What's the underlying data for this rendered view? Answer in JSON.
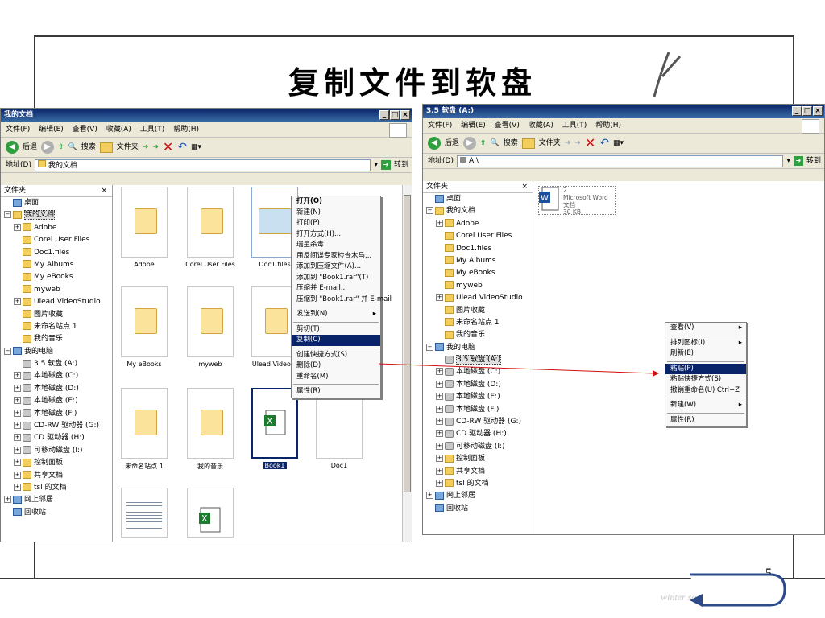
{
  "slide": {
    "title": "复制文件到软盘",
    "page_number": "5",
    "footer": "winter solitude - nlo"
  },
  "left_window": {
    "title": "我的文档",
    "menu": [
      "文件(F)",
      "编辑(E)",
      "查看(V)",
      "收藏(A)",
      "工具(T)",
      "帮助(H)"
    ],
    "toolbar": {
      "back": "后退",
      "search": "搜索",
      "folders": "文件夹"
    },
    "address_label": "地址(D)",
    "address_value": "我的文档",
    "go_label": "转到",
    "tree_header": "文件夹",
    "tree": [
      {
        "label": "桌面",
        "icon": "desktop-icon",
        "indent": 0,
        "plus": ""
      },
      {
        "label": "我的文档",
        "icon": "folder-icon",
        "indent": 0,
        "plus": "−",
        "selected": true
      },
      {
        "label": "Adobe",
        "icon": "folder-icon",
        "indent": 1,
        "plus": "+"
      },
      {
        "label": "Corel User Files",
        "icon": "folder-icon",
        "indent": 1,
        "plus": ""
      },
      {
        "label": "Doc1.files",
        "icon": "folder-icon",
        "indent": 1,
        "plus": ""
      },
      {
        "label": "My Albums",
        "icon": "folder-icon",
        "indent": 1,
        "plus": ""
      },
      {
        "label": "My eBooks",
        "icon": "folder-icon",
        "indent": 1,
        "plus": ""
      },
      {
        "label": "myweb",
        "icon": "folder-icon",
        "indent": 1,
        "plus": ""
      },
      {
        "label": "Ulead VideoStudio",
        "icon": "folder-icon",
        "indent": 1,
        "plus": "+"
      },
      {
        "label": "图片收藏",
        "icon": "folder-icon",
        "indent": 1,
        "plus": ""
      },
      {
        "label": "未命名站点 1",
        "icon": "folder-icon",
        "indent": 1,
        "plus": ""
      },
      {
        "label": "我的音乐",
        "icon": "folder-icon",
        "indent": 1,
        "plus": ""
      },
      {
        "label": "我的电脑",
        "icon": "computer-icon",
        "indent": 0,
        "plus": "−"
      },
      {
        "label": "3.5 软盘 (A:)",
        "icon": "floppy-icon",
        "indent": 1,
        "plus": ""
      },
      {
        "label": "本地磁盘 (C:)",
        "icon": "drive-icon",
        "indent": 1,
        "plus": "+"
      },
      {
        "label": "本地磁盘 (D:)",
        "icon": "drive-icon",
        "indent": 1,
        "plus": "+"
      },
      {
        "label": "本地磁盘 (E:)",
        "icon": "drive-icon",
        "indent": 1,
        "plus": "+"
      },
      {
        "label": "本地磁盘 (F:)",
        "icon": "drive-icon",
        "indent": 1,
        "plus": "+"
      },
      {
        "label": "CD-RW 驱动器 (G:)",
        "icon": "cd-icon",
        "indent": 1,
        "plus": "+"
      },
      {
        "label": "CD 驱动器 (H:)",
        "icon": "cd-icon",
        "indent": 1,
        "plus": "+"
      },
      {
        "label": "可移动磁盘 (I:)",
        "icon": "drive-icon",
        "indent": 1,
        "plus": "+"
      },
      {
        "label": "控制面板",
        "icon": "folder-icon",
        "indent": 1,
        "plus": "+"
      },
      {
        "label": "共享文档",
        "icon": "folder-icon",
        "indent": 1,
        "plus": "+"
      },
      {
        "label": "tsl 的文档",
        "icon": "folder-icon",
        "indent": 1,
        "plus": "+"
      },
      {
        "label": "网上邻居",
        "icon": "network-icon",
        "indent": 0,
        "plus": "+"
      },
      {
        "label": "回收站",
        "icon": "recycle-icon",
        "indent": 0,
        "plus": ""
      }
    ],
    "files": [
      "Adobe",
      "Corel User Files",
      "Doc1.files",
      "My eBooks",
      "myweb",
      "Ulead VideoSt",
      "未命名站点 1",
      "我的音乐",
      "Book1",
      "Doc1"
    ],
    "context_menu": [
      {
        "label": "打开(O)",
        "bold": true
      },
      {
        "label": "新建(N)"
      },
      {
        "label": "打印(P)"
      },
      {
        "label": "打开方式(H)..."
      },
      {
        "label": "瑞星杀毒"
      },
      {
        "label": "用反间谍专家检查木马..."
      },
      {
        "label": "添加到压缩文件(A)..."
      },
      {
        "label": "添加到 \"Book1.rar\"(T)"
      },
      {
        "label": "压缩并 E-mail..."
      },
      {
        "label": "压缩到 \"Book1.rar\" 并 E-mail"
      },
      {
        "sep": true
      },
      {
        "label": "发送到(N)",
        "arrow": "▸"
      },
      {
        "sep": true
      },
      {
        "label": "剪切(T)"
      },
      {
        "label": "复制(C)",
        "highlight": true
      },
      {
        "sep": true
      },
      {
        "label": "创建快捷方式(S)"
      },
      {
        "label": "删除(D)"
      },
      {
        "label": "重命名(M)"
      },
      {
        "sep": true
      },
      {
        "label": "属性(R)"
      }
    ]
  },
  "right_window": {
    "title": "3.5 软盘 (A:)",
    "menu": [
      "文件(F)",
      "编辑(E)",
      "查看(V)",
      "收藏(A)",
      "工具(T)",
      "帮助(H)"
    ],
    "toolbar": {
      "back": "后退",
      "search": "搜索",
      "folders": "文件夹"
    },
    "address_label": "地址(D)",
    "address_value": "A:\\",
    "go_label": "转到",
    "tree_header": "文件夹",
    "tree": [
      {
        "label": "桌面",
        "icon": "desktop-icon",
        "indent": 0,
        "plus": ""
      },
      {
        "label": "我的文档",
        "icon": "folder-icon",
        "indent": 0,
        "plus": "−"
      },
      {
        "label": "Adobe",
        "icon": "folder-icon",
        "indent": 1,
        "plus": "+"
      },
      {
        "label": "Corel User Files",
        "icon": "folder-icon",
        "indent": 1,
        "plus": ""
      },
      {
        "label": "Doc1.files",
        "icon": "folder-icon",
        "indent": 1,
        "plus": ""
      },
      {
        "label": "My Albums",
        "icon": "folder-icon",
        "indent": 1,
        "plus": ""
      },
      {
        "label": "My eBooks",
        "icon": "folder-icon",
        "indent": 1,
        "plus": ""
      },
      {
        "label": "myweb",
        "icon": "folder-icon",
        "indent": 1,
        "plus": ""
      },
      {
        "label": "Ulead VideoStudio",
        "icon": "folder-icon",
        "indent": 1,
        "plus": "+"
      },
      {
        "label": "图片收藏",
        "icon": "folder-icon",
        "indent": 1,
        "plus": ""
      },
      {
        "label": "未命名站点 1",
        "icon": "folder-icon",
        "indent": 1,
        "plus": ""
      },
      {
        "label": "我的音乐",
        "icon": "folder-icon",
        "indent": 1,
        "plus": ""
      },
      {
        "label": "我的电脑",
        "icon": "computer-icon",
        "indent": 0,
        "plus": "−"
      },
      {
        "label": "3.5 软盘 (A:)",
        "icon": "floppy-icon",
        "indent": 1,
        "plus": "",
        "selected": true
      },
      {
        "label": "本地磁盘 (C:)",
        "icon": "drive-icon",
        "indent": 1,
        "plus": "+"
      },
      {
        "label": "本地磁盘 (D:)",
        "icon": "drive-icon",
        "indent": 1,
        "plus": "+"
      },
      {
        "label": "本地磁盘 (E:)",
        "icon": "drive-icon",
        "indent": 1,
        "plus": "+"
      },
      {
        "label": "本地磁盘 (F:)",
        "icon": "drive-icon",
        "indent": 1,
        "plus": "+"
      },
      {
        "label": "CD-RW 驱动器 (G:)",
        "icon": "cd-icon",
        "indent": 1,
        "plus": "+"
      },
      {
        "label": "CD 驱动器 (H:)",
        "icon": "cd-icon",
        "indent": 1,
        "plus": "+"
      },
      {
        "label": "可移动磁盘 (I:)",
        "icon": "drive-icon",
        "indent": 1,
        "plus": "+"
      },
      {
        "label": "控制面板",
        "icon": "folder-icon",
        "indent": 1,
        "plus": "+"
      },
      {
        "label": "共享文档",
        "icon": "folder-icon",
        "indent": 1,
        "plus": "+"
      },
      {
        "label": "tsl 的文档",
        "icon": "folder-icon",
        "indent": 1,
        "plus": "+"
      },
      {
        "label": "网上邻居",
        "icon": "network-icon",
        "indent": 0,
        "plus": "+"
      },
      {
        "label": "回收站",
        "icon": "recycle-icon",
        "indent": 0,
        "plus": ""
      }
    ],
    "file": {
      "name": "2",
      "type": "Microsoft Word 文档",
      "size": "30 KB"
    },
    "context_menu": [
      {
        "label": "查看(V)",
        "arrow": "▸"
      },
      {
        "sep": true
      },
      {
        "label": "排列图标(I)",
        "arrow": "▸"
      },
      {
        "label": "刷新(E)"
      },
      {
        "sep": true
      },
      {
        "label": "粘贴(P)",
        "highlight": true
      },
      {
        "label": "粘贴快捷方式(S)"
      },
      {
        "label": "撤销重命名(U)",
        "shortcut": "Ctrl+Z"
      },
      {
        "sep": true
      },
      {
        "label": "新建(W)",
        "arrow": "▸"
      },
      {
        "sep": true
      },
      {
        "label": "属性(R)"
      }
    ]
  },
  "colors": {
    "title_bar": "#0a246a",
    "highlight": "#0a246a",
    "arrow": "#d01010",
    "folder": "#f2cf5c"
  }
}
